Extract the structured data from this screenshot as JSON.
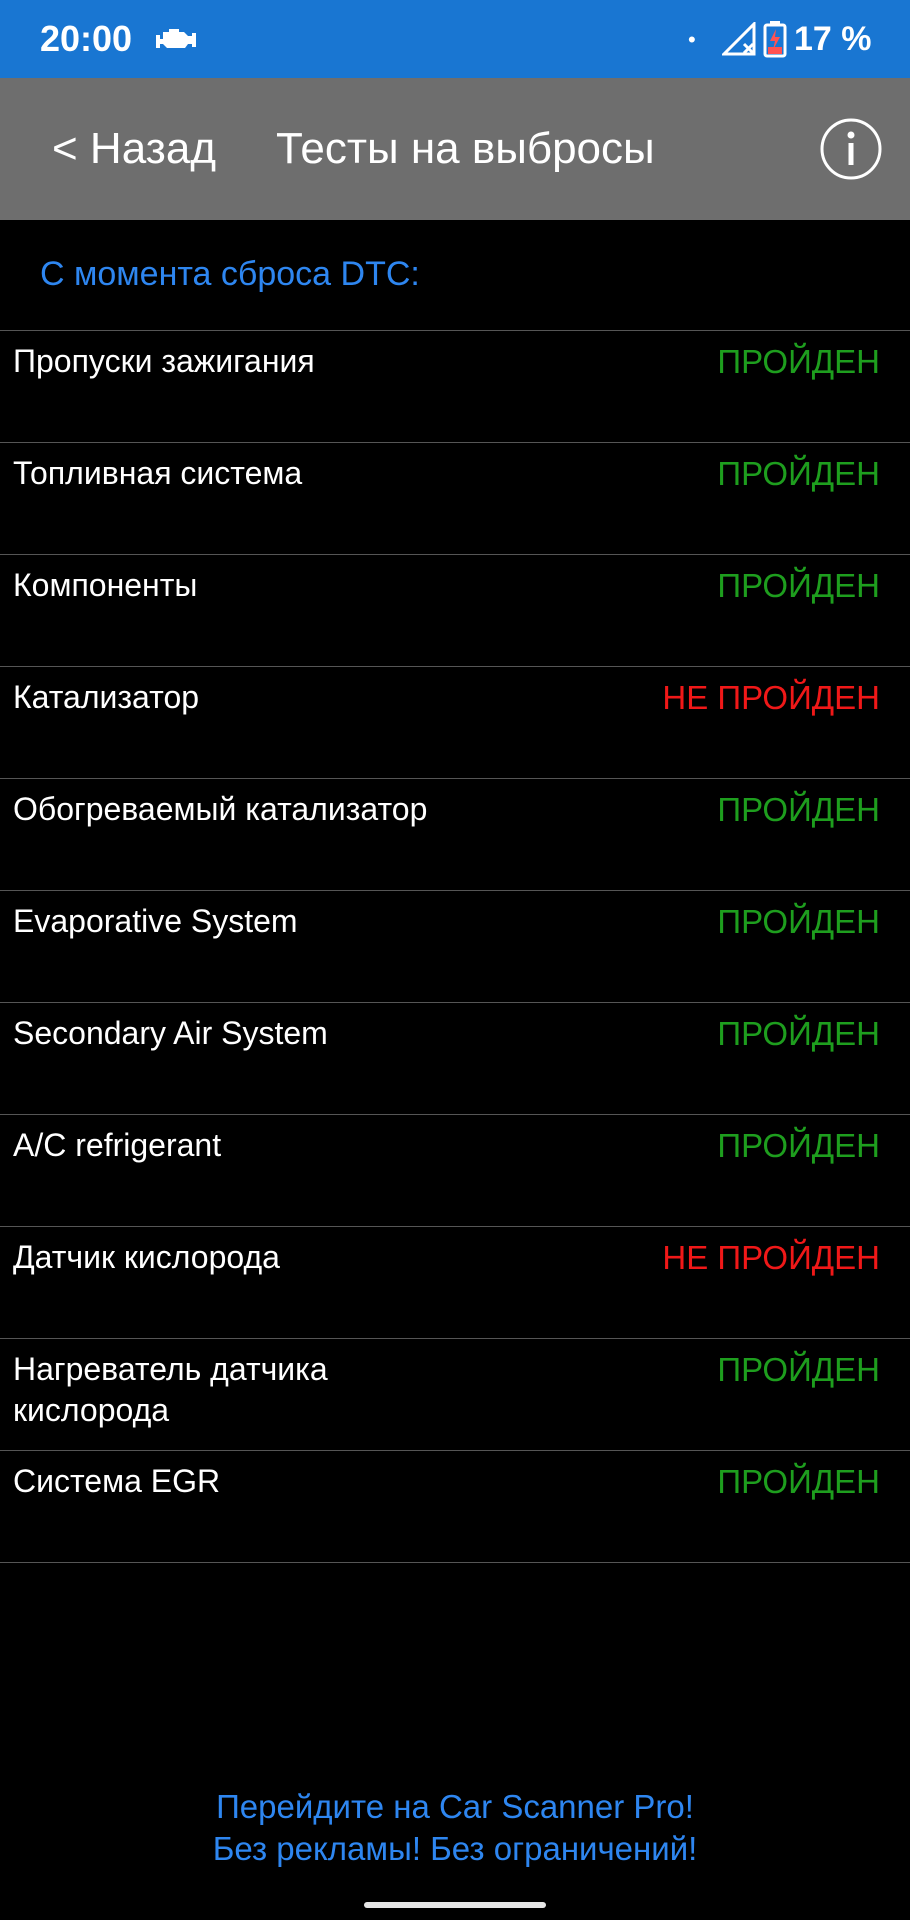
{
  "status_bar": {
    "time": "20:00",
    "dot": "•",
    "battery_text": "17 %",
    "icons": [
      "engine-icon",
      "signal-no-data-icon",
      "battery-charging-icon"
    ]
  },
  "toolbar": {
    "back_label": "< Назад",
    "title": "Тесты на выбросы",
    "info_icon": "info-icon"
  },
  "section_header": "С момента сброса DTC:",
  "tests": [
    {
      "name": "Пропуски зажигания",
      "status": "ПРОЙДЕН",
      "result": "passed"
    },
    {
      "name": "Топливная система",
      "status": "ПРОЙДЕН",
      "result": "passed"
    },
    {
      "name": "Компоненты",
      "status": "ПРОЙДЕН",
      "result": "passed"
    },
    {
      "name": "Катализатор",
      "status": "НЕ ПРОЙДЕН",
      "result": "failed"
    },
    {
      "name": "Обогреваемый катализатор",
      "status": "ПРОЙДЕН",
      "result": "passed"
    },
    {
      "name": "Evaporative System",
      "status": "ПРОЙДЕН",
      "result": "passed"
    },
    {
      "name": "Secondary Air System",
      "status": "ПРОЙДЕН",
      "result": "passed"
    },
    {
      "name": "A/C refrigerant",
      "status": "ПРОЙДЕН",
      "result": "passed"
    },
    {
      "name": "Датчик кислорода",
      "status": "НЕ ПРОЙДЕН",
      "result": "failed"
    },
    {
      "name": "Нагреватель датчика кислорода",
      "status": "ПРОЙДЕН",
      "result": "passed"
    },
    {
      "name": "Система EGR",
      "status": "ПРОЙДЕН",
      "result": "passed"
    }
  ],
  "promo": {
    "line1": "Перейдите на Car Scanner Pro!",
    "line2": "Без рекламы! Без ограничений!"
  },
  "colors": {
    "status_bar": "#1976d2",
    "toolbar": "#6e6e6e",
    "accent": "#2e86f0",
    "passed": "#1e9e1e",
    "failed": "#f01818"
  }
}
